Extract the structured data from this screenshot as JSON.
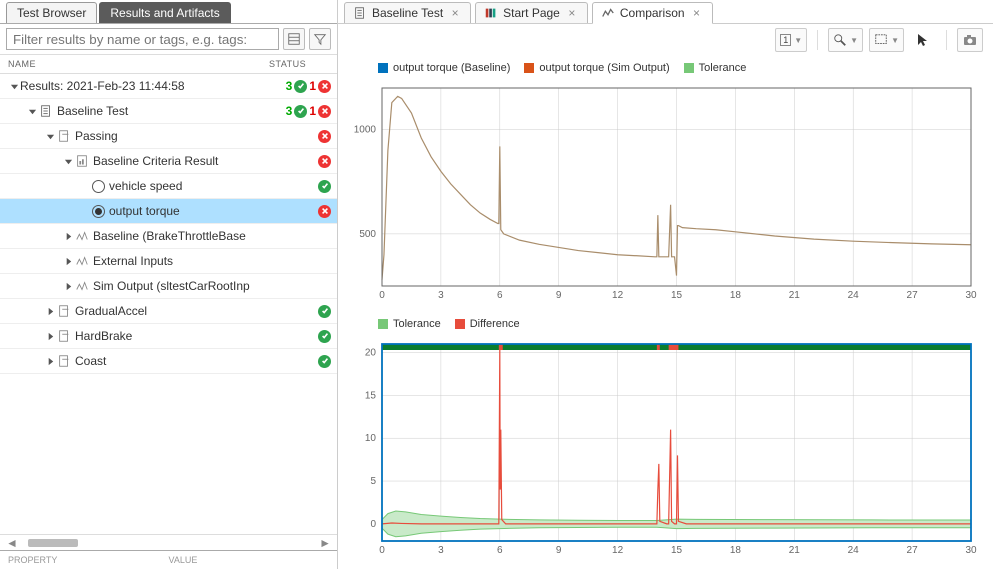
{
  "left_panel": {
    "tabs": {
      "browser": "Test Browser",
      "results": "Results and Artifacts"
    },
    "filter_placeholder": "Filter results by name or tags, e.g. tags:",
    "columns": {
      "name": "NAME",
      "status": "STATUS"
    },
    "property_cols": {
      "prop": "PROPERTY",
      "val": "VALUE"
    },
    "tree": [
      {
        "indent": 0,
        "twisty": "open",
        "icon": "none",
        "label": "Results: 2021-Feb-23 11:44:58",
        "status": {
          "pass": 3,
          "fail": 1
        }
      },
      {
        "indent": 1,
        "twisty": "open",
        "icon": "doc",
        "label": "Baseline Test",
        "status": {
          "pass": 3,
          "fail": 1
        }
      },
      {
        "indent": 2,
        "twisty": "open",
        "icon": "passbox",
        "label": "Passing",
        "status": {
          "fail_circ": true
        }
      },
      {
        "indent": 3,
        "twisty": "open",
        "icon": "chartdoc",
        "label": "Baseline Criteria Result",
        "status": {
          "fail_circ": true
        }
      },
      {
        "indent": 4,
        "twisty": "none",
        "icon": "radio",
        "label": "vehicle speed",
        "status": {
          "pass_circ": true
        }
      },
      {
        "indent": 4,
        "twisty": "none",
        "icon": "radio_sel",
        "label": "output torque",
        "selected": true,
        "status": {
          "fail_circ": true
        }
      },
      {
        "indent": 3,
        "twisty": "closed",
        "icon": "signal",
        "label": "Baseline (BrakeThrottleBase",
        "status": {}
      },
      {
        "indent": 3,
        "twisty": "closed",
        "icon": "signal",
        "label": "External Inputs",
        "status": {}
      },
      {
        "indent": 3,
        "twisty": "closed",
        "icon": "signal",
        "label": "Sim Output (sltestCarRootInp",
        "status": {}
      },
      {
        "indent": 2,
        "twisty": "closed",
        "icon": "passbox",
        "label": "GradualAccel",
        "status": {
          "pass_circ": true
        }
      },
      {
        "indent": 2,
        "twisty": "closed",
        "icon": "passbox",
        "label": "HardBrake",
        "status": {
          "pass_circ": true
        }
      },
      {
        "indent": 2,
        "twisty": "closed",
        "icon": "passbox",
        "label": "Coast",
        "status": {
          "pass_circ": true
        }
      }
    ]
  },
  "right_panel": {
    "tabs": [
      {
        "icon": "doc",
        "label": "Baseline Test",
        "closable": true
      },
      {
        "icon": "books",
        "label": "Start Page",
        "closable": true
      },
      {
        "icon": "chart",
        "label": "Comparison",
        "closable": true,
        "active": true
      }
    ],
    "toolbar_badge": "1"
  },
  "chart_data": [
    {
      "type": "line",
      "xlabel": "",
      "ylabel": "",
      "xlim": [
        0,
        30
      ],
      "ylim": [
        250,
        1200
      ],
      "xticks": [
        0,
        3,
        6,
        9,
        12,
        15,
        18,
        21,
        24,
        27,
        30
      ],
      "yticks": [
        500,
        1000
      ],
      "legend": [
        {
          "name": "output torque (Baseline)",
          "color": "#0072bd"
        },
        {
          "name": "output torque (Sim Output)",
          "color": "#d95319"
        },
        {
          "name": "Tolerance",
          "color": "#77c877"
        }
      ],
      "series": [
        {
          "name": "signal",
          "color": "#a98d6b",
          "data": [
            [
              0.0,
              280
            ],
            [
              0.1,
              400
            ],
            [
              0.3,
              900
            ],
            [
              0.5,
              1130
            ],
            [
              0.8,
              1160
            ],
            [
              1.0,
              1150
            ],
            [
              1.5,
              1080
            ],
            [
              2,
              960
            ],
            [
              2.5,
              870
            ],
            [
              3,
              800
            ],
            [
              3.5,
              740
            ],
            [
              4,
              690
            ],
            [
              4.5,
              640
            ],
            [
              5,
              600
            ],
            [
              5.5,
              570
            ],
            [
              5.9,
              550
            ],
            [
              5.95,
              550
            ],
            [
              6.0,
              920
            ],
            [
              6.05,
              520
            ],
            [
              6.2,
              500
            ],
            [
              7,
              470
            ],
            [
              8,
              450
            ],
            [
              9,
              435
            ],
            [
              10,
              420
            ],
            [
              11,
              410
            ],
            [
              12,
              400
            ],
            [
              13,
              395
            ],
            [
              13.9,
              390
            ],
            [
              14.0,
              390
            ],
            [
              14.05,
              590
            ],
            [
              14.1,
              390
            ],
            [
              14.6,
              390
            ],
            [
              14.7,
              640
            ],
            [
              14.75,
              390
            ],
            [
              14.9,
              390
            ],
            [
              15.0,
              300
            ],
            [
              15.05,
              540
            ],
            [
              15.1,
              540
            ],
            [
              15.3,
              530
            ],
            [
              16,
              525
            ],
            [
              17,
              520
            ],
            [
              18,
              510
            ],
            [
              20,
              490
            ],
            [
              22,
              475
            ],
            [
              24,
              465
            ],
            [
              26,
              458
            ],
            [
              28,
              452
            ],
            [
              30,
              448
            ]
          ]
        }
      ]
    },
    {
      "type": "line",
      "xlabel": "",
      "ylabel": "",
      "xlim": [
        0,
        30
      ],
      "ylim": [
        -2,
        21
      ],
      "xticks": [
        0,
        3,
        6,
        9,
        12,
        15,
        18,
        21,
        24,
        27,
        30
      ],
      "yticks": [
        0,
        5,
        10,
        15,
        20
      ],
      "frame_color": "#0072bd",
      "legend": [
        {
          "name": "Tolerance",
          "color": "#77c877"
        },
        {
          "name": "Difference",
          "color": "#e74c3c"
        }
      ],
      "topbar": {
        "pass_color": "#0a7d2f",
        "fail_color": "#e74c3c",
        "fail_segments": [
          [
            5.95,
            6.15
          ],
          [
            14.0,
            14.15
          ],
          [
            14.6,
            15.1
          ]
        ]
      },
      "series": [
        {
          "name": "tolerance_band",
          "type": "band",
          "fill": "#c9eac9",
          "stroke": "#77c877",
          "upper": [
            [
              0,
              0.5
            ],
            [
              0.3,
              1.2
            ],
            [
              0.7,
              1.5
            ],
            [
              1.2,
              1.4
            ],
            [
              2,
              1.1
            ],
            [
              3,
              0.9
            ],
            [
              4,
              0.75
            ],
            [
              5,
              0.62
            ],
            [
              6,
              0.55
            ],
            [
              8,
              0.46
            ],
            [
              10,
              0.42
            ],
            [
              12,
              0.4
            ],
            [
              14,
              0.4
            ],
            [
              15,
              0.55
            ],
            [
              16,
              0.53
            ],
            [
              20,
              0.49
            ],
            [
              25,
              0.46
            ],
            [
              30,
              0.45
            ]
          ],
          "lower": [
            [
              0,
              -0.5
            ],
            [
              0.3,
              -1.2
            ],
            [
              0.7,
              -1.5
            ],
            [
              1.2,
              -1.4
            ],
            [
              2,
              -1.1
            ],
            [
              3,
              -0.9
            ],
            [
              4,
              -0.75
            ],
            [
              5,
              -0.62
            ],
            [
              6,
              -0.55
            ],
            [
              8,
              -0.46
            ],
            [
              10,
              -0.42
            ],
            [
              12,
              -0.4
            ],
            [
              14,
              -0.4
            ],
            [
              15,
              -0.55
            ],
            [
              16,
              -0.53
            ],
            [
              20,
              -0.49
            ],
            [
              25,
              -0.46
            ],
            [
              30,
              -0.45
            ]
          ]
        },
        {
          "name": "Difference",
          "color": "#e74c3c",
          "data": [
            [
              0,
              0
            ],
            [
              0.5,
              0.1
            ],
            [
              1,
              0.05
            ],
            [
              2,
              0
            ],
            [
              3,
              0
            ],
            [
              4,
              0
            ],
            [
              5,
              0
            ],
            [
              5.9,
              0
            ],
            [
              5.95,
              0
            ],
            [
              6.0,
              20.5
            ],
            [
              6.02,
              4
            ],
            [
              6.05,
              11
            ],
            [
              6.1,
              0.5
            ],
            [
              6.3,
              0
            ],
            [
              7,
              0
            ],
            [
              8,
              0
            ],
            [
              10,
              0
            ],
            [
              12,
              0
            ],
            [
              13.9,
              0
            ],
            [
              14.0,
              0
            ],
            [
              14.05,
              4
            ],
            [
              14.1,
              7
            ],
            [
              14.15,
              0.3
            ],
            [
              14.5,
              0
            ],
            [
              14.6,
              0
            ],
            [
              14.7,
              11
            ],
            [
              14.75,
              0.3
            ],
            [
              14.9,
              0
            ],
            [
              15.0,
              0
            ],
            [
              15.05,
              8
            ],
            [
              15.1,
              0.3
            ],
            [
              15.5,
              0
            ],
            [
              17,
              0
            ],
            [
              20,
              0
            ],
            [
              25,
              0
            ],
            [
              30,
              0
            ]
          ]
        }
      ]
    }
  ]
}
